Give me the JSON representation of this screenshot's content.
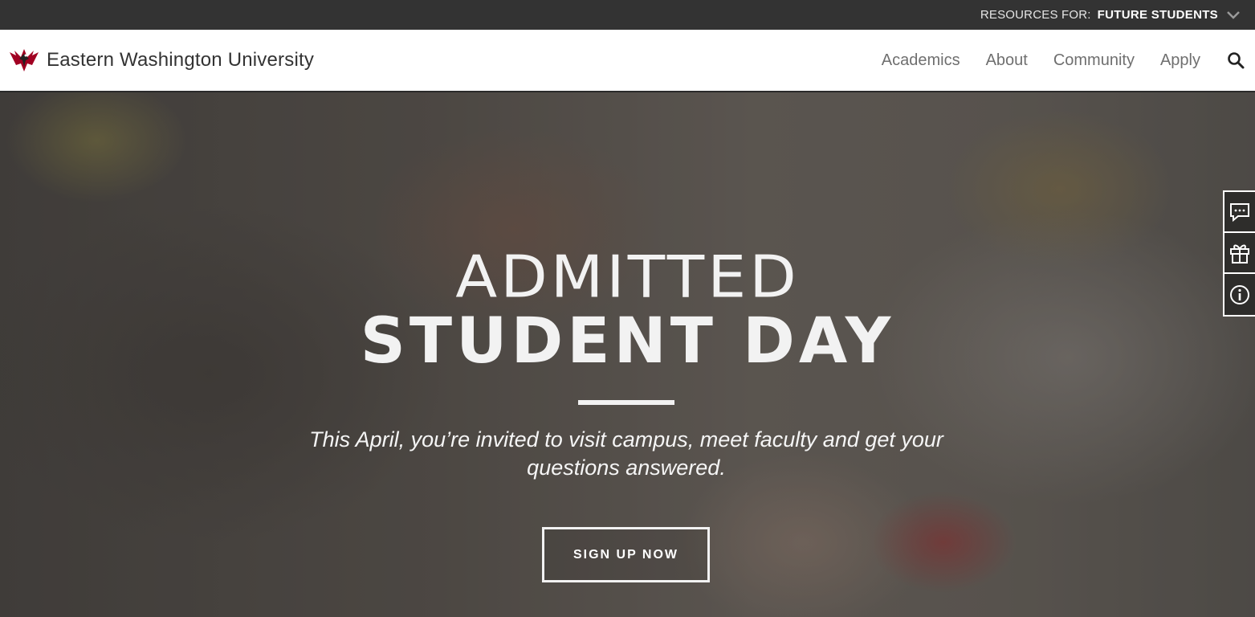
{
  "topbar": {
    "resources_label": "RESOURCES FOR:",
    "resources_value": "FUTURE STUDENTS",
    "dropdown_icon": "chevron-down-icon"
  },
  "header": {
    "site_name": "Eastern Washington University",
    "logo_icon": "eagle-logo",
    "nav": [
      {
        "label": "Academics"
      },
      {
        "label": "About"
      },
      {
        "label": "Community"
      },
      {
        "label": "Apply"
      }
    ],
    "search_icon": "search-icon"
  },
  "hero": {
    "line1": "ADMITTED",
    "line2": "STUDENT DAY",
    "subtitle": "This April, you’re invited to visit campus, meet faculty and get your questions answered.",
    "cta_label": "SIGN UP NOW"
  },
  "side_tools": [
    {
      "icon": "chat-icon"
    },
    {
      "icon": "gift-icon"
    },
    {
      "icon": "info-icon"
    }
  ],
  "colors": {
    "topbar_bg": "#333333",
    "header_bg": "#ffffff",
    "nav_text": "#6f6f6f",
    "brand_red": "#a10022",
    "hero_text": "#f2f2f2"
  }
}
